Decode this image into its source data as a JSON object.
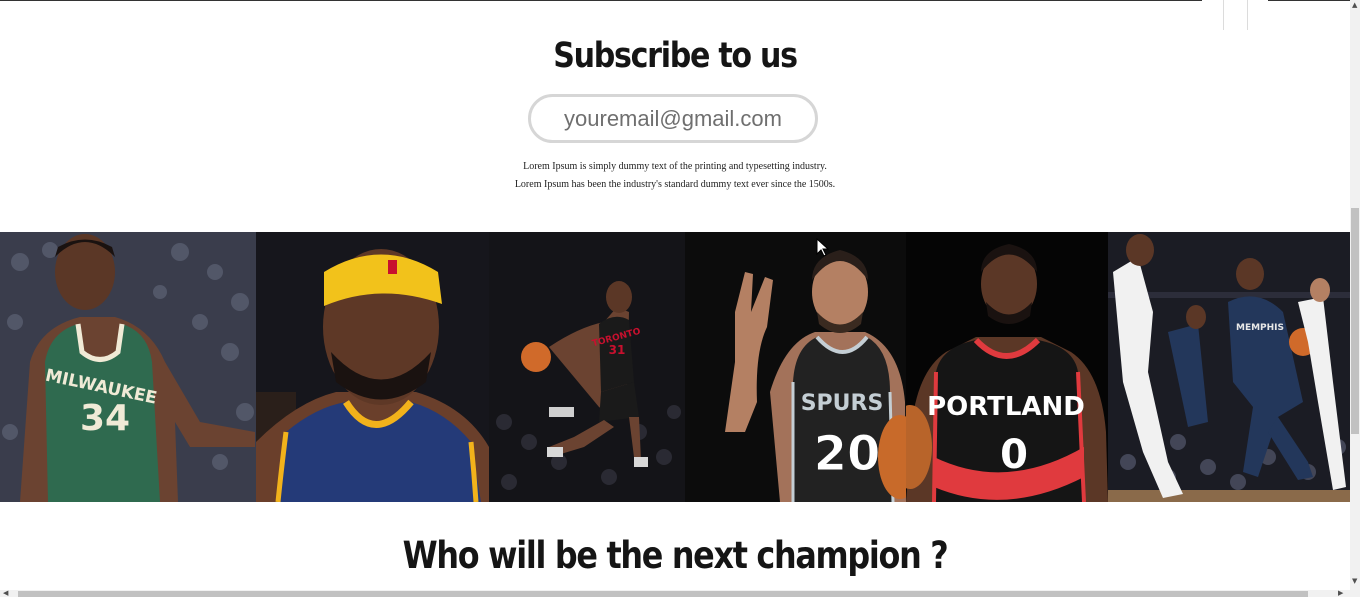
{
  "subscribe": {
    "title": "Subscribe to us",
    "email_placeholder": "youremail@gmail.com",
    "description_line_1": "Lorem Ipsum is simply dummy text of the printing and typesetting industry.",
    "description_line_2": "Lorem Ipsum has been the industry's standard dummy text ever since the 1500s."
  },
  "gallery": {
    "photos": [
      {
        "team": "MILWAUKEE",
        "number": "34",
        "jersey_color": "#2f6a4f",
        "trim_color": "#f0ead6",
        "bg_color": "#3a3a4a"
      },
      {
        "team": "",
        "number": "",
        "jersey_color": "#243a78",
        "trim_color": "#f2b21b",
        "bg_color": "#1a1a22"
      },
      {
        "team": "TORONTO",
        "number": "31",
        "jersey_color": "#1a1a1a",
        "trim_color": "#c8102e",
        "bg_color": "#141418"
      },
      {
        "team": "SPURS",
        "number": "20",
        "jersey_color": "#222222",
        "trim_color": "#c4ced4",
        "bg_color": "#0c0c0c"
      },
      {
        "team": "PORTLAND",
        "number": "0",
        "jersey_color": "#151515",
        "trim_color": "#e03a3e",
        "bg_color": "#050505"
      },
      {
        "team": "MEMPHIS",
        "number": "",
        "jersey_color": "#23375b",
        "trim_color": "#e8e8e8",
        "bg_color": "#1b1c24"
      }
    ]
  },
  "champion": {
    "title": "Who will be the next champion ?"
  },
  "colors": {
    "text_dark": "#151515",
    "input_border": "#d6d6d6",
    "placeholder": "#6f6f6f"
  }
}
